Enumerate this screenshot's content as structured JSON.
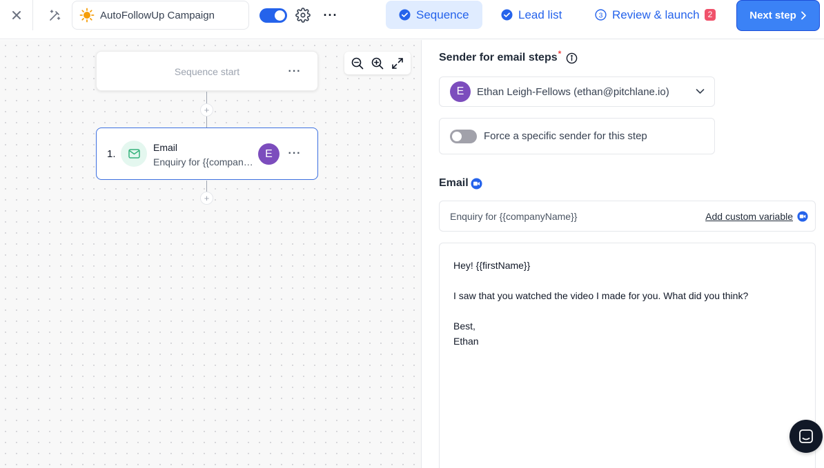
{
  "topbar": {
    "campaign_name": "AutoFollowUp Campaign",
    "campaign_enabled": true,
    "tabs": [
      {
        "label": "Sequence",
        "state": "active"
      },
      {
        "label": "Lead list",
        "state": "done"
      },
      {
        "label": "Review & launch",
        "step": "3",
        "badge": "2"
      }
    ],
    "next_label": "Next step"
  },
  "canvas": {
    "start_label": "Sequence start",
    "steps": [
      {
        "number": "1.",
        "title": "Email",
        "subtitle": "Enquiry for {{companyName}}",
        "avatar": "E"
      }
    ]
  },
  "panel": {
    "sender_heading": "Sender for email steps",
    "required_mark": "*",
    "sender": {
      "avatar": "E",
      "value": "Ethan Leigh-Fellows (ethan@pitchlane.io)"
    },
    "force_sender_label": "Force a specific sender for this step",
    "force_sender_on": false,
    "email_heading": "Email",
    "subject": "Enquiry for {{companyName}}",
    "add_variable_label": "Add custom variable",
    "body_lines": [
      "Hey! {{firstName}}",
      "",
      "I saw that you watched the video I made for you. What did you think?",
      "",
      "Best,",
      "Ethan"
    ]
  },
  "colors": {
    "accent": "#2563eb",
    "next_button": "#3b82f6",
    "badge": "#f0526b",
    "avatar": "#7c4dbd",
    "email_icon_bg": "#e4f7ef"
  }
}
